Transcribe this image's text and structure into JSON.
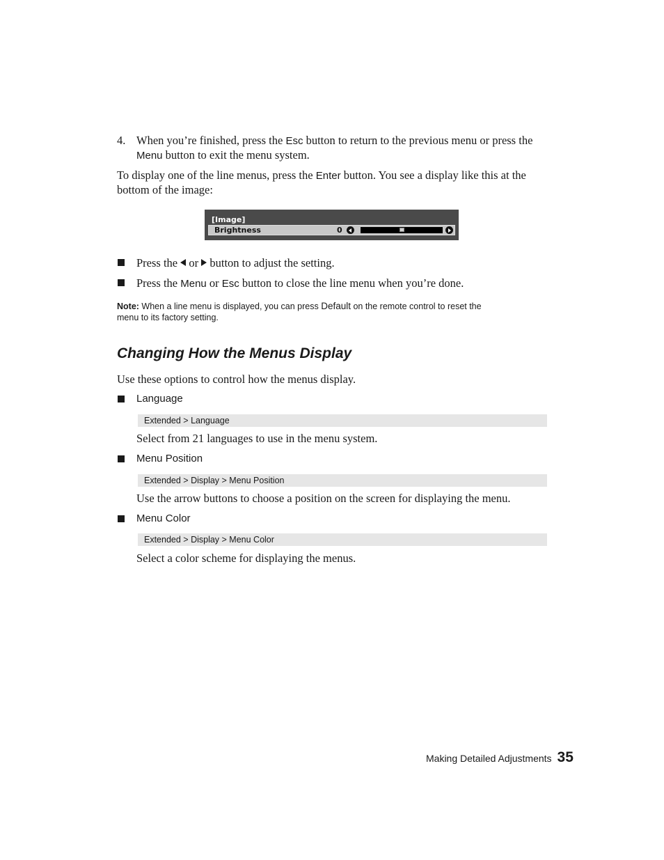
{
  "step4": {
    "number": "4.",
    "line1_pre": "When you’re finished, press the ",
    "line1_kw": "Esc",
    "line1_post": " button to return to the previous menu or press the",
    "line2_kw": "Menu",
    "line2_post": " button to exit the menu system."
  },
  "intro": {
    "pre": "To display one of the line menus, press the ",
    "kw": "Enter",
    "post": " button. You see a display like this at the",
    "line2": "bottom of the image:"
  },
  "osd": {
    "title": "[Image]",
    "label": "Brightness",
    "value": "0",
    "slider_fraction": 0.5,
    "left_arrow_icon": "left-arrow-icon",
    "right_arrow_icon": "right-arrow-icon"
  },
  "bullets": [
    {
      "pre": "Press the ",
      "mid": " or ",
      "post": " button to adjust the setting."
    },
    {
      "pre": "Press the ",
      "kw1": "Menu",
      "mid": " or ",
      "kw2": "Esc",
      "post": " button to close the line menu when you’re done."
    }
  ],
  "note": {
    "label": "Note:",
    "pre": " When a line menu is displayed, you can press ",
    "kw": "Default",
    "post": " on the remote control to reset the",
    "line2": "menu to its factory setting."
  },
  "section": {
    "heading": "Changing How the Menus Display",
    "intro": "Use these options to control how the menus display.",
    "options": [
      {
        "name": "Language",
        "path": "Extended > Language",
        "desc": "Select from 21 languages to use in the menu system."
      },
      {
        "name": "Menu Position",
        "path": "Extended > Display > Menu Position",
        "desc": "Use the arrow buttons to choose a position on the screen for displaying the menu."
      },
      {
        "name": "Menu Color",
        "path": "Extended > Display > Menu Color",
        "desc": "Select a color scheme for displaying the menus."
      }
    ]
  },
  "footer": {
    "chapter": "Making Detailed Adjustments",
    "page": "35"
  }
}
